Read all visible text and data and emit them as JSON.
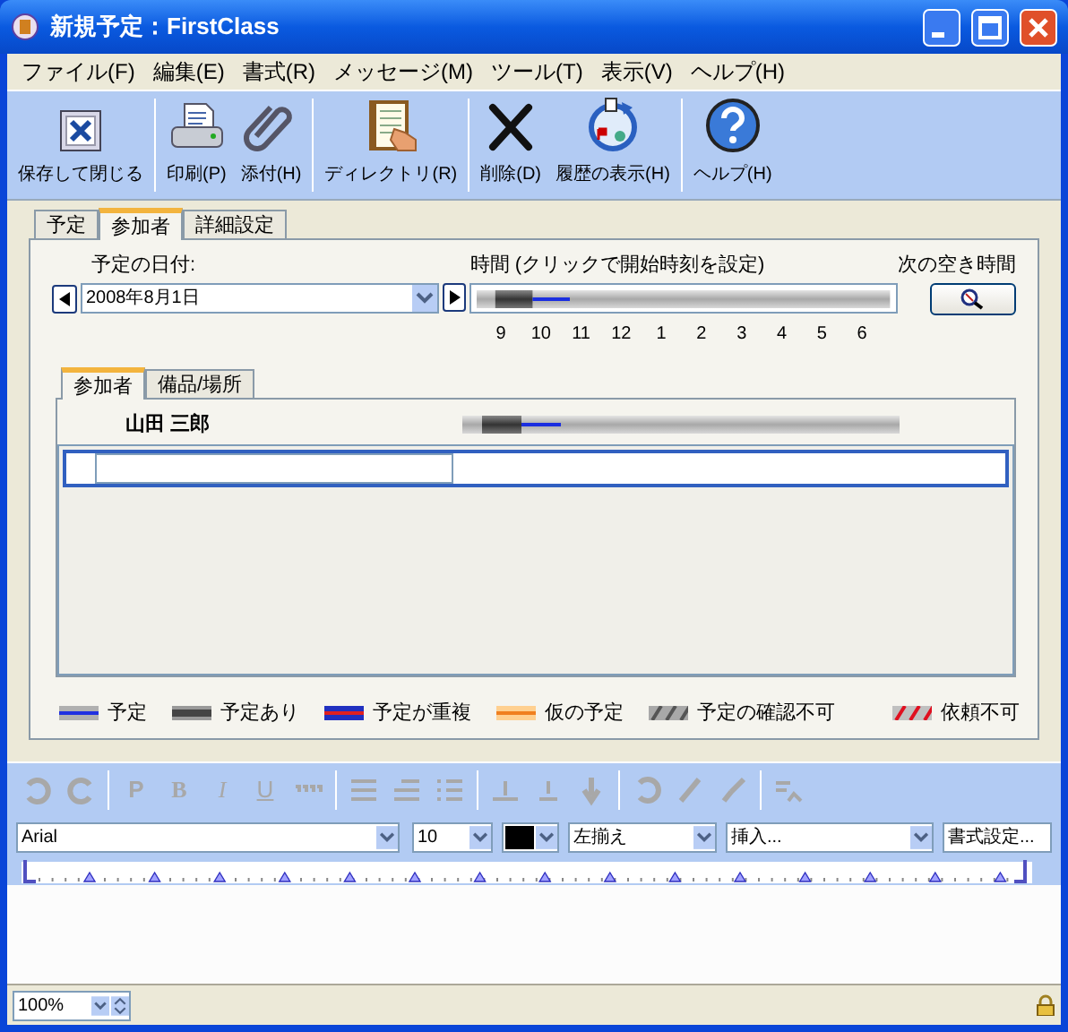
{
  "window": {
    "title": "新規予定：FirstClass"
  },
  "menu": [
    "ファイル(F)",
    "編集(E)",
    "書式(R)",
    "メッセージ(M)",
    "ツール(T)",
    "表示(V)",
    "ヘルプ(H)"
  ],
  "toolbar_groups": [
    [
      {
        "kind": "save",
        "label": "保存して閉じる"
      }
    ],
    [
      {
        "kind": "print",
        "label": "印刷(P)"
      },
      {
        "kind": "attach",
        "label": "添付(H)"
      }
    ],
    [
      {
        "kind": "directory",
        "label": "ディレクトリ(R)"
      }
    ],
    [
      {
        "kind": "delete",
        "label": "削除(D)"
      },
      {
        "kind": "history",
        "label": "履歴の表示(H)"
      }
    ],
    [
      {
        "kind": "help",
        "label": "ヘルプ(H)"
      }
    ]
  ],
  "tabs": [
    {
      "label": "予定",
      "selected": false
    },
    {
      "label": "参加者",
      "selected": true
    },
    {
      "label": "詳細設定",
      "selected": false
    }
  ],
  "date": {
    "label": "予定の日付:",
    "value": "2008年8月1日"
  },
  "time": {
    "label": "時間 (クリックで開始時刻を設定)",
    "hours": [
      "9",
      "10",
      "11",
      "12",
      "1",
      "2",
      "3",
      "4",
      "5",
      "6"
    ]
  },
  "next_free": {
    "label": "次の空き時間"
  },
  "sub_tabs": [
    {
      "label": "参加者",
      "selected": true
    },
    {
      "label": "備品/場所",
      "selected": false
    }
  ],
  "attendees": [
    {
      "name": "山田 三郎"
    }
  ],
  "legend": [
    {
      "kind": "scheduled",
      "label": "予定"
    },
    {
      "kind": "busy",
      "label": "予定あり"
    },
    {
      "kind": "conflict",
      "label": "予定が重複"
    },
    {
      "kind": "tentative",
      "label": "仮の予定"
    },
    {
      "kind": "unknown",
      "label": "予定の確認不可"
    },
    {
      "kind": "unavailable",
      "label": "依頼不可"
    }
  ],
  "format_letters": [
    {
      "label": "P",
      "disabled": true
    },
    {
      "label": "B",
      "disabled": true
    },
    {
      "label": "I",
      "disabled": true
    },
    {
      "label": "U",
      "disabled": true
    }
  ],
  "font": {
    "value": "Arial"
  },
  "size": {
    "value": "10"
  },
  "align": {
    "value": "左揃え"
  },
  "insert": {
    "value": "挿入..."
  },
  "style": {
    "value": "書式設定..."
  },
  "zoom": {
    "value": "100%"
  }
}
